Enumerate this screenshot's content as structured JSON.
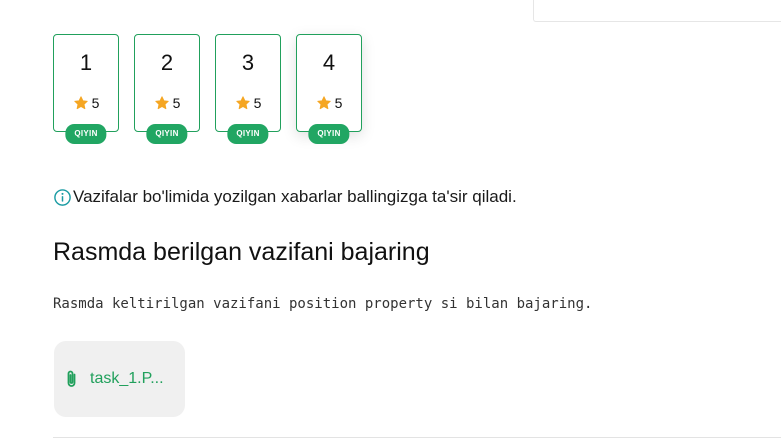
{
  "tasks": [
    {
      "number": "1",
      "score": "5",
      "difficulty": "QIYIN"
    },
    {
      "number": "2",
      "score": "5",
      "difficulty": "QIYIN"
    },
    {
      "number": "3",
      "score": "5",
      "difficulty": "QIYIN"
    },
    {
      "number": "4",
      "score": "5",
      "difficulty": "QIYIN"
    }
  ],
  "notice": {
    "icon": "info-icon",
    "text": "Vazifalar bo'limida yozilgan xabarlar ballingizga ta'sir qiladi."
  },
  "task": {
    "title": "Rasmda berilgan vazifani bajaring",
    "description": "Rasmda keltirilgan vazifani position property si bilan bajaring."
  },
  "attachment": {
    "icon": "paperclip-icon",
    "name": "task_1.P..."
  },
  "colors": {
    "accent": "#21a05c",
    "badge": "#21a663",
    "star": "#f5a623",
    "info": "#1a9ba3"
  }
}
